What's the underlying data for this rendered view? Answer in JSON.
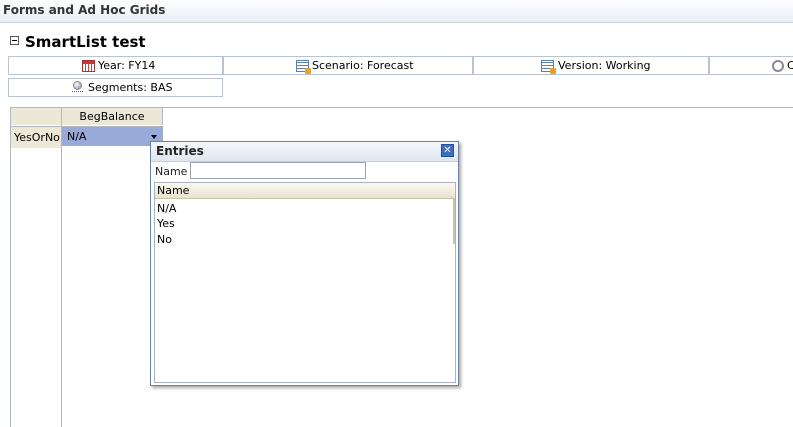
{
  "app": {
    "header_title": "Forms and Ad Hoc Grids"
  },
  "form": {
    "title": "SmartList test"
  },
  "pov": {
    "year": "Year: FY14",
    "scenario": "Scenario: Forecast",
    "version": "Version: Working",
    "fourth_partial": "C",
    "segments": "Segments: BAS"
  },
  "grid": {
    "column_header": "BegBalance",
    "row_header": "YesOrNo",
    "cell_value": "N/A"
  },
  "entries_popup": {
    "title": "Entries",
    "search_label": "Name",
    "search_value": "",
    "list_header": "Name",
    "items": [
      "N/A",
      "Yes",
      "No"
    ]
  }
}
